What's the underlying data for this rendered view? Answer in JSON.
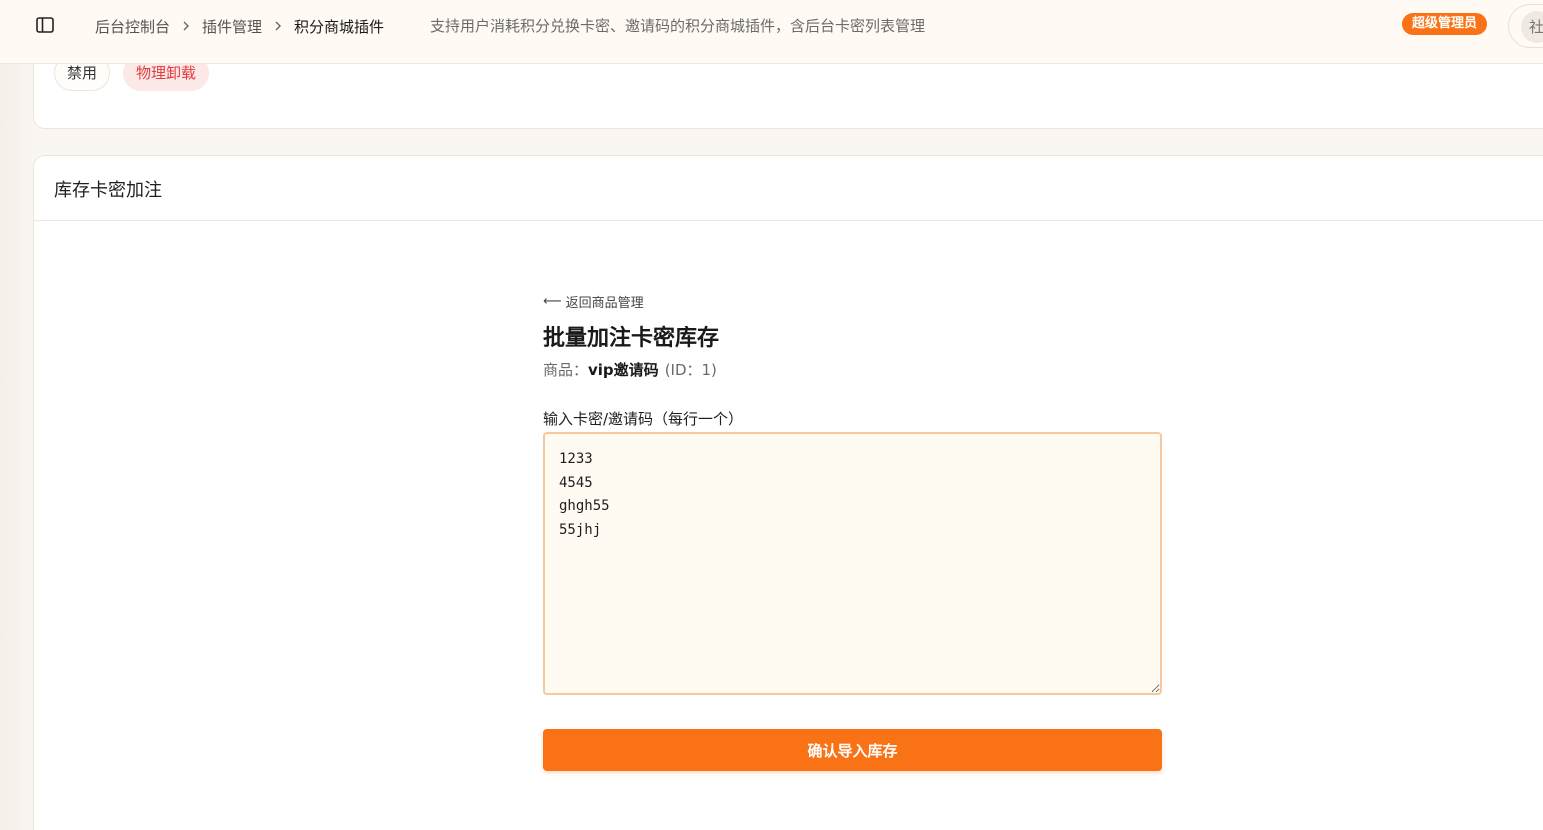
{
  "header": {
    "breadcrumb": [
      "后台控制台",
      "插件管理",
      "积分商城插件"
    ],
    "description": "支持用户消耗积分兑换卡密、邀请码的积分商城插件，含后台卡密列表管理",
    "role_badge": "超级管理员",
    "avatar_text": "社",
    "accent_color": "#f97316"
  },
  "plugin_actions": {
    "disable_label": "禁用",
    "uninstall_label": "物理卸载",
    "danger_color": "#e23d3d"
  },
  "panel": {
    "title": "库存卡密加注"
  },
  "form": {
    "back_label": "返回商品管理",
    "title": "批量加注卡密库存",
    "product_prefix": "商品：",
    "product_name": "vip邀请码",
    "product_id": "(ID：1)",
    "field_label": "输入卡密/邀请码（每行一个）",
    "codes_value": "1233\n4545\nghgh55\n55jhj",
    "submit_label": "确认导入库存"
  }
}
